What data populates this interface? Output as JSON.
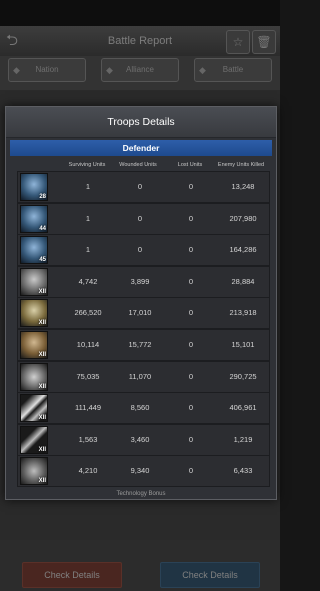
{
  "background": {
    "title": "Battle Report",
    "tabs": [
      "Nation",
      "Alliance",
      "Battle"
    ],
    "check_buttons": [
      "Check Details",
      "Check Details"
    ]
  },
  "modal": {
    "title": "Troops Details",
    "section": "Defender",
    "columns": [
      "Surviving Units",
      "Wounded Units",
      "Lost Units",
      "Enemy Units Killed"
    ],
    "rows": [
      {
        "icon": "hero-portrait-icon",
        "level": "28",
        "surviving": "1",
        "wounded": "0",
        "lost": "0",
        "killed": "13,248"
      },
      {
        "icon": "hero-portrait-icon",
        "level": "44",
        "surviving": "1",
        "wounded": "0",
        "lost": "0",
        "killed": "207,980"
      },
      {
        "icon": "hero-portrait-icon",
        "level": "45",
        "surviving": "1",
        "wounded": "0",
        "lost": "0",
        "killed": "164,286"
      },
      {
        "icon": "infantry-unit-icon",
        "level": "XII",
        "surviving": "4,742",
        "wounded": "3,899",
        "lost": "0",
        "killed": "28,884"
      },
      {
        "icon": "guardian-unit-icon",
        "level": "XII",
        "surviving": "266,520",
        "wounded": "17,010",
        "lost": "0",
        "killed": "213,918"
      },
      {
        "icon": "mech-unit-icon",
        "level": "XII",
        "surviving": "10,114",
        "wounded": "15,772",
        "lost": "0",
        "killed": "15,101"
      },
      {
        "icon": "tank-unit-icon",
        "level": "XII",
        "surviving": "75,035",
        "wounded": "11,070",
        "lost": "0",
        "killed": "290,725"
      },
      {
        "icon": "missile-unit-icon",
        "level": "XII",
        "surviving": "111,449",
        "wounded": "8,560",
        "lost": "0",
        "killed": "406,961"
      },
      {
        "icon": "sniper-rifle-icon",
        "level": "XII",
        "surviving": "1,563",
        "wounded": "3,460",
        "lost": "0",
        "killed": "1,219"
      },
      {
        "icon": "artillery-unit-icon",
        "level": "XII",
        "surviving": "4,210",
        "wounded": "9,340",
        "lost": "0",
        "killed": "6,433"
      }
    ],
    "footer": "Technology Bonus"
  },
  "colors": {
    "section_header": "#2456a0",
    "modal_bg": "#2f3136",
    "text": "#d5d5d5"
  }
}
